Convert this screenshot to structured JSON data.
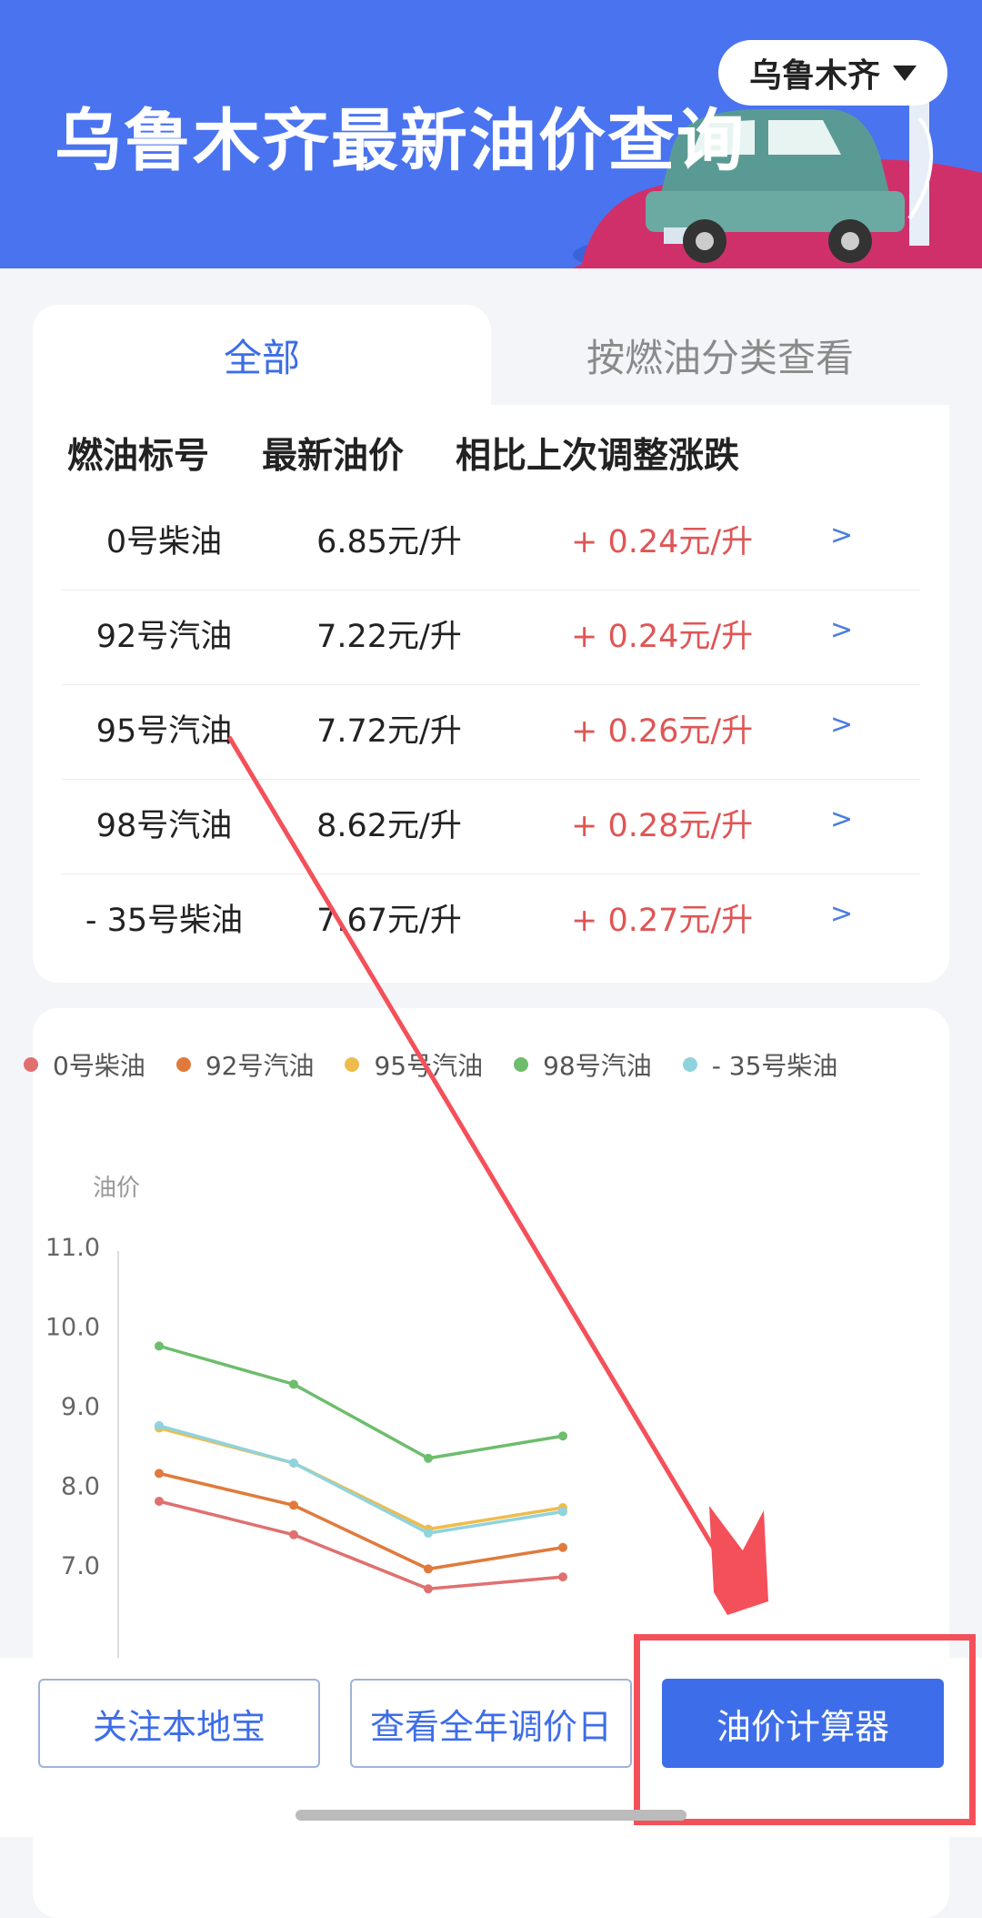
{
  "header": {
    "title": "乌鲁木齐最新油价查询",
    "city": "乌鲁木齐",
    "bg_color": "#4a73f0"
  },
  "tabs": [
    {
      "label": "全部",
      "active": true
    },
    {
      "label": "按燃油分类查看",
      "active": false
    }
  ],
  "table": {
    "columns": [
      "燃油标号",
      "最新油价",
      "相比上次调整涨跌"
    ],
    "rows": [
      {
        "name": "0号柴油",
        "price": "6.85元/升",
        "change": "+ 0.24元/升",
        "arrow": ">"
      },
      {
        "name": "92号汽油",
        "price": "7.22元/升",
        "change": "+ 0.24元/升",
        "arrow": ">"
      },
      {
        "name": "95号汽油",
        "price": "7.72元/升",
        "change": "+ 0.26元/升",
        "arrow": ">"
      },
      {
        "name": "98号汽油",
        "price": "8.62元/升",
        "change": "+ 0.28元/升",
        "arrow": ">"
      },
      {
        "name": "- 35号柴油",
        "price": "7.67元/升",
        "change": "+ 0.27元/升",
        "arrow": ">"
      }
    ]
  },
  "chart_data": {
    "type": "line",
    "title": "",
    "ylabel": "油价",
    "xlabel": "",
    "yticks": [
      "11.0",
      "10.0",
      "9.0",
      "8.0",
      "7.0"
    ],
    "ylim": [
      7.0,
      11.0
    ],
    "grid": false,
    "legend_position": "top",
    "x": [
      1,
      2,
      3,
      4
    ],
    "series": [
      {
        "name": "0号柴油",
        "color": "#e07070",
        "values": [
          7.8,
          7.38,
          6.7,
          6.85
        ]
      },
      {
        "name": "92号汽油",
        "color": "#e07a3c",
        "values": [
          8.15,
          7.75,
          6.95,
          7.22
        ]
      },
      {
        "name": "95号汽油",
        "color": "#eebc4c",
        "values": [
          8.72,
          8.28,
          7.45,
          7.72
        ]
      },
      {
        "name": "98号汽油",
        "color": "#6dbd6d",
        "values": [
          9.75,
          9.27,
          8.34,
          8.62
        ]
      },
      {
        "name": "- 35号柴油",
        "color": "#8fd3dd",
        "values": [
          8.75,
          8.28,
          7.4,
          7.67
        ]
      }
    ]
  },
  "buttons": {
    "follow": "关注本地宝",
    "calendar": "查看全年调价日",
    "calculator": "油价计算器"
  },
  "colors": {
    "accent": "#3d6de8",
    "rise": "#e05555",
    "annotation": "#f4505a"
  }
}
